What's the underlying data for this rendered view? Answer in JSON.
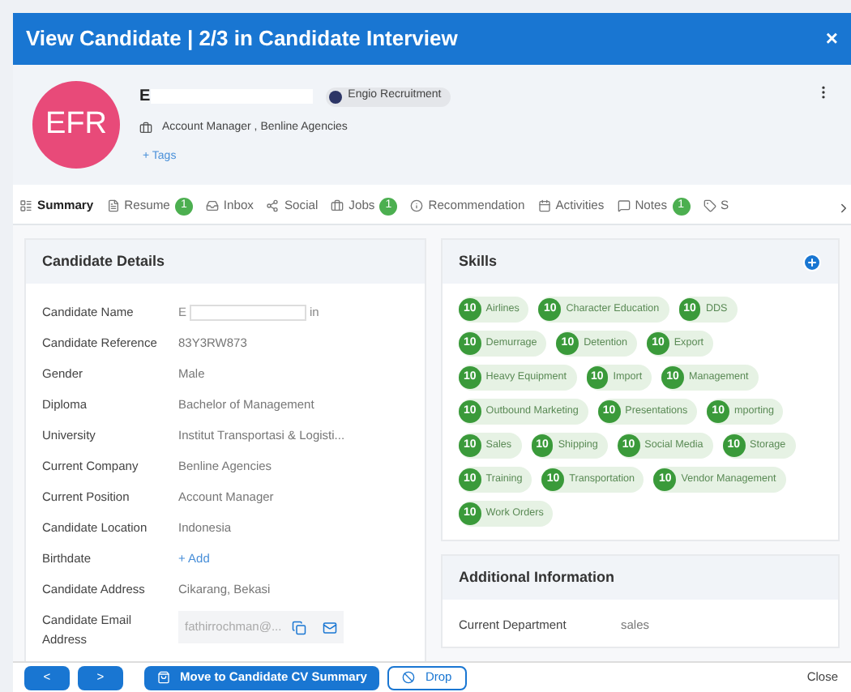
{
  "window": {
    "title": "View Candidate | 2/3 in Candidate Interview",
    "close": "×"
  },
  "header": {
    "avatar": "EFR",
    "name_start": "E",
    "company_tag": "Engio Recruitment",
    "position": "Account Manager , Benline Agencies",
    "tags_link": "+ Tags"
  },
  "tabs": [
    {
      "label": "Summary",
      "selected": true
    },
    {
      "label": "Resume",
      "badge": "1",
      "selected": false
    },
    {
      "label": "Inbox",
      "selected": false
    },
    {
      "label": "Social",
      "selected": false
    },
    {
      "label": "Jobs",
      "badge": "1",
      "selected": false
    },
    {
      "label": "Recommendation",
      "selected": false
    },
    {
      "label": "Activities",
      "selected": false
    },
    {
      "label": "Notes",
      "badge": "1",
      "selected": false
    },
    {
      "label": "S",
      "selected": false
    }
  ],
  "candidate_details": {
    "title": "Candidate Details",
    "rows": [
      {
        "label": "Candidate Name",
        "kind": "redacted",
        "start": "E",
        "end": "in"
      },
      {
        "label": "Candidate Reference",
        "kind": "text",
        "value": "83Y3RW873"
      },
      {
        "label": "Gender",
        "kind": "text",
        "value": "Male"
      },
      {
        "label": "Diploma",
        "kind": "text",
        "value": "Bachelor of Management"
      },
      {
        "label": "University",
        "kind": "text",
        "value": "Institut Transportasi & Logisti..."
      },
      {
        "label": "Current Company",
        "kind": "text",
        "value": "Benline Agencies"
      },
      {
        "label": "Current Position",
        "kind": "text",
        "value": "Account Manager"
      },
      {
        "label": "Candidate Location",
        "kind": "text",
        "value": "Indonesia"
      },
      {
        "label": "Birthdate",
        "kind": "add",
        "value": "+ Add"
      },
      {
        "label": "Candidate Address",
        "kind": "text",
        "value": "Cikarang, Bekasi"
      },
      {
        "label": "Candidate Email Address",
        "kind": "email",
        "value": "fathirrochman@..."
      }
    ]
  },
  "skills": {
    "title": "Skills",
    "items": [
      {
        "count": "10",
        "name": "Airlines"
      },
      {
        "count": "10",
        "name": "Character Education"
      },
      {
        "count": "10",
        "name": "DDS"
      },
      {
        "count": "10",
        "name": "Demurrage"
      },
      {
        "count": "10",
        "name": "Detention"
      },
      {
        "count": "10",
        "name": "Export"
      },
      {
        "count": "10",
        "name": "Heavy Equipment"
      },
      {
        "count": "10",
        "name": "Import"
      },
      {
        "count": "10",
        "name": "Management"
      },
      {
        "count": "10",
        "name": "Outbound Marketing"
      },
      {
        "count": "10",
        "name": "Presentations"
      },
      {
        "count": "10",
        "name": "mporting"
      },
      {
        "count": "10",
        "name": "Sales"
      },
      {
        "count": "10",
        "name": "Shipping"
      },
      {
        "count": "10",
        "name": "Social Media"
      },
      {
        "count": "10",
        "name": "Storage"
      },
      {
        "count": "10",
        "name": "Training"
      },
      {
        "count": "10",
        "name": "Transportation"
      },
      {
        "count": "10",
        "name": "Vendor Management"
      },
      {
        "count": "10",
        "name": "Work Orders"
      }
    ]
  },
  "additional_information": {
    "title": "Additional Information",
    "rows": [
      {
        "label": "Current Department",
        "value": "sales"
      }
    ]
  },
  "footer": {
    "prev": "<",
    "next": ">",
    "move_button": "Move to Candidate CV Summary",
    "drop_button": "Drop",
    "close_button": "Close"
  }
}
